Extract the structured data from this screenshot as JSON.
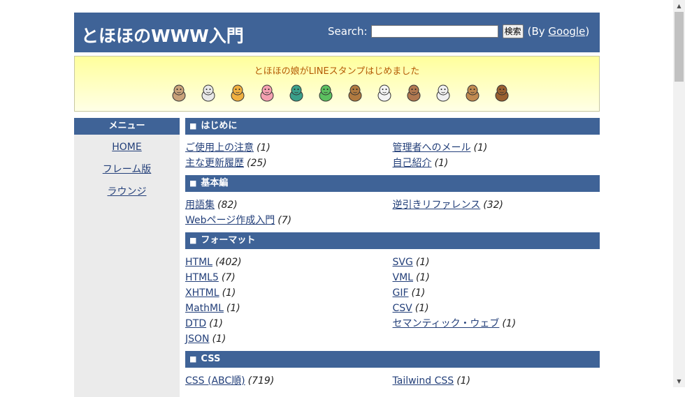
{
  "header": {
    "title": "とほほのWWW入門",
    "search_label": "Search:",
    "search_value": "",
    "search_button": "検索",
    "by_prefix": "(By ",
    "google_link": "Google",
    "by_suffix": ")"
  },
  "banner": {
    "text": "とほほの娘がLINEスタンプはじめました",
    "stickers": [
      "mouse-sticker-icon",
      "cow-sticker-icon",
      "tiger-sticker-icon",
      "rabbit-sticker-icon",
      "dragon-sticker-icon",
      "snake-sticker-icon",
      "horse-sticker-icon",
      "sheep-sticker-icon",
      "monkey-sticker-icon",
      "rooster-sticker-icon",
      "dog-sticker-icon",
      "boar-sticker-icon"
    ]
  },
  "sidebar": {
    "heading": "メニュー",
    "items": [
      {
        "label": "HOME"
      },
      {
        "label": "フレーム版"
      },
      {
        "label": "ラウンジ"
      }
    ]
  },
  "sections": [
    {
      "marker": "■",
      "title": "はじめに",
      "rows": [
        [
          {
            "label": "ご使用上の注意",
            "count": "(1)"
          },
          {
            "label": "管理者へのメール",
            "count": "(1)"
          }
        ],
        [
          {
            "label": "主な更新履歴",
            "count": "(25)"
          },
          {
            "label": "自己紹介",
            "count": "(1)"
          }
        ]
      ]
    },
    {
      "marker": "■",
      "title": "基本編",
      "rows": [
        [
          {
            "label": "用語集",
            "count": "(82)"
          },
          {
            "label": "逆引きリファレンス",
            "count": "(32)"
          }
        ],
        [
          {
            "label": "Webページ作成入門",
            "count": "(7)"
          },
          null
        ]
      ]
    },
    {
      "marker": "■",
      "title": "フォーマット",
      "rows": [
        [
          {
            "label": "HTML",
            "count": "(402)"
          },
          {
            "label": "SVG",
            "count": "(1)"
          }
        ],
        [
          {
            "label": "HTML5",
            "count": "(7)"
          },
          {
            "label": "VML",
            "count": "(1)"
          }
        ],
        [
          {
            "label": "XHTML",
            "count": "(1)"
          },
          {
            "label": "GIF",
            "count": "(1)"
          }
        ],
        [
          {
            "label": "MathML",
            "count": "(1)"
          },
          {
            "label": "CSV",
            "count": "(1)"
          }
        ],
        [
          {
            "label": "DTD",
            "count": "(1)"
          },
          {
            "label": "セマンティック・ウェブ",
            "count": "(1)"
          }
        ],
        [
          {
            "label": "JSON",
            "count": "(1)"
          },
          null
        ]
      ]
    },
    {
      "marker": "■",
      "title": "CSS",
      "rows": [
        [
          {
            "label": "CSS (ABC順)",
            "count": "(719)"
          },
          {
            "label": "Tailwind CSS",
            "count": "(1)"
          }
        ]
      ]
    }
  ],
  "colors": {
    "header_bg": "#3f6397",
    "link": "#24407a",
    "banner_text": "#b45a05"
  }
}
